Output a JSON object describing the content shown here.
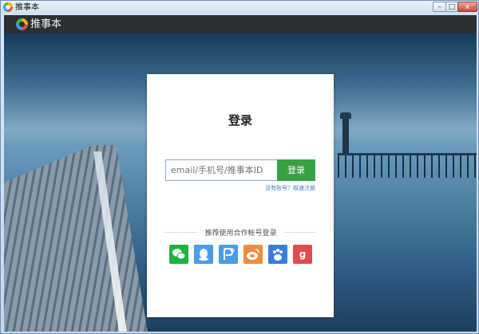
{
  "window": {
    "title": "推事本",
    "btn_min": "–",
    "btn_max": "□",
    "btn_close": "x"
  },
  "appbar": {
    "name": "推事本"
  },
  "login": {
    "title": "登录",
    "input_placeholder": "email/手机号/推事本ID",
    "button_label": "登录",
    "register_text": "没有账号？极速注册",
    "partner_label": "推荐使用合作帐号登录"
  },
  "social": [
    {
      "name": "wechat",
      "color": "#19b43c"
    },
    {
      "name": "qq",
      "color": "#4a9de8"
    },
    {
      "name": "alipay",
      "color": "#4a9de8"
    },
    {
      "name": "weibo",
      "color": "#f28b3a"
    },
    {
      "name": "baidu",
      "color": "#3a7cdd"
    },
    {
      "name": "google",
      "color": "#e24b4b",
      "glyph": "g"
    }
  ]
}
